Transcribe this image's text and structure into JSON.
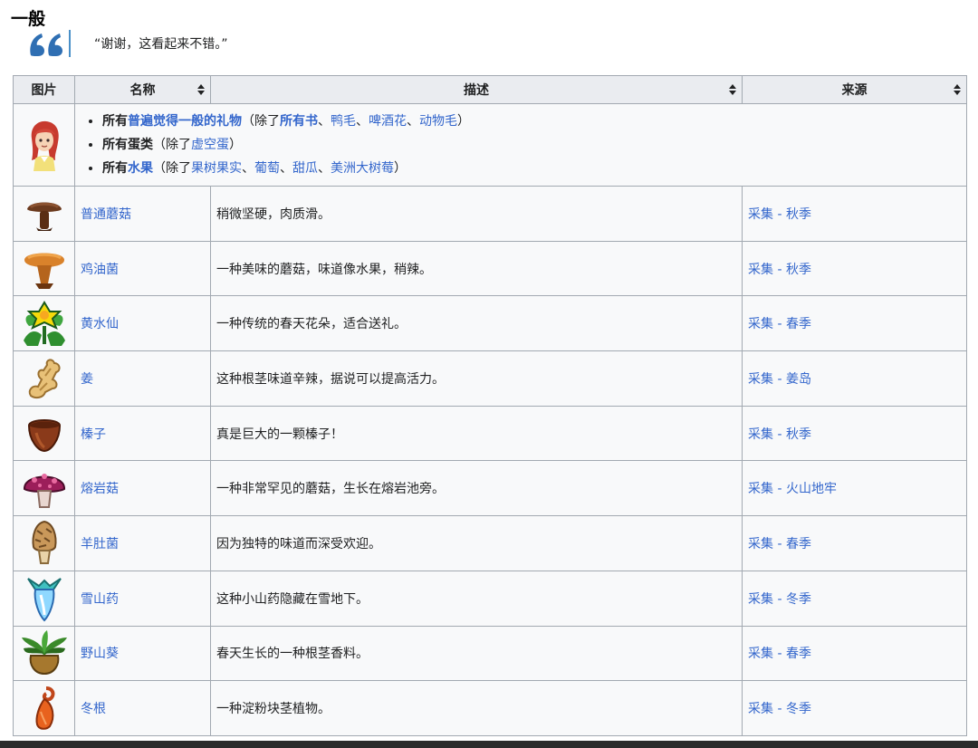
{
  "section": {
    "title": "一般",
    "quote": "“谢谢，这看起来不错。”"
  },
  "table": {
    "headers": {
      "image": "图片",
      "name": "名称",
      "description": "描述",
      "source": "来源"
    },
    "summary": {
      "line1": {
        "prefix": "所有",
        "link": "普遍觉得一般的礼物",
        "paren_open": "（除了",
        "link2": "所有书",
        "sep1": "、",
        "item1": "鸭毛",
        "sep2": "、",
        "item2": "啤酒花",
        "sep3": "、",
        "item3": "动物毛",
        "paren_close": "）"
      },
      "line2": {
        "prefix": "所有蛋类",
        "paren_open": "（除了",
        "item1": "虚空蛋",
        "paren_close": "）"
      },
      "line3": {
        "prefix": "所有",
        "link": "水果",
        "paren_open": "（除了",
        "item1": "果树果实",
        "sep1": "、",
        "item2": "葡萄",
        "sep2": "、",
        "item3": "甜瓜",
        "sep3": "、",
        "item4": "美洲大树莓",
        "paren_close": "）"
      }
    },
    "rows": [
      {
        "name": "普通蘑菇",
        "description": "稍微坚硬，肉质滑。",
        "source": "采集 - 秋季",
        "icon": "common-mushroom-icon"
      },
      {
        "name": "鸡油菌",
        "description": "一种美味的蘑菇，味道像水果，稍辣。",
        "source": "采集 - 秋季",
        "icon": "chanterelle-icon"
      },
      {
        "name": "黄水仙",
        "description": "一种传统的春天花朵，适合送礼。",
        "source": "采集 - 春季",
        "icon": "daffodil-icon"
      },
      {
        "name": "姜",
        "description": "这种根茎味道辛辣，据说可以提高活力。",
        "source": "采集 - 姜岛",
        "icon": "ginger-icon"
      },
      {
        "name": "榛子",
        "description": "真是巨大的一颗榛子！",
        "source": "采集 - 秋季",
        "icon": "hazelnut-icon"
      },
      {
        "name": "熔岩菇",
        "description": "一种非常罕见的蘑菇，生长在熔岩池旁。",
        "source": "采集 - 火山地牢",
        "icon": "magma-cap-icon"
      },
      {
        "name": "羊肚菌",
        "description": "因为独特的味道而深受欢迎。",
        "source": "采集 - 春季",
        "icon": "morel-icon"
      },
      {
        "name": "雪山药",
        "description": "这种小山药隐藏在雪地下。",
        "source": "采集 - 冬季",
        "icon": "snow-yam-icon"
      },
      {
        "name": "野山葵",
        "description": "春天生长的一种根茎香料。",
        "source": "采集 - 春季",
        "icon": "wild-horseradish-icon"
      },
      {
        "name": "冬根",
        "description": "一种淀粉块茎植物。",
        "source": "采集 - 冬季",
        "icon": "winter-root-icon"
      }
    ]
  }
}
